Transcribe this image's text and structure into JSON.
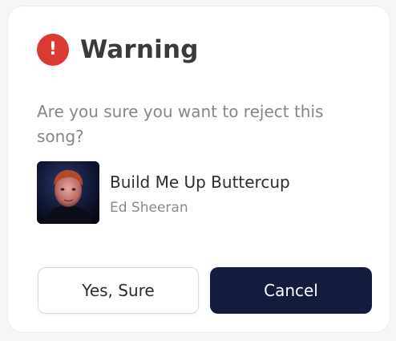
{
  "dialog": {
    "icon": "exclamation-icon",
    "title": "Warning",
    "message": "Are you sure you want to reject this song?"
  },
  "song": {
    "title": "Build Me Up Buttercup",
    "artist": "Ed Sheeran"
  },
  "buttons": {
    "confirm_label": "Yes, Sure",
    "cancel_label": "Cancel"
  },
  "colors": {
    "warning": "#d93b34",
    "primary": "#141c3e"
  }
}
